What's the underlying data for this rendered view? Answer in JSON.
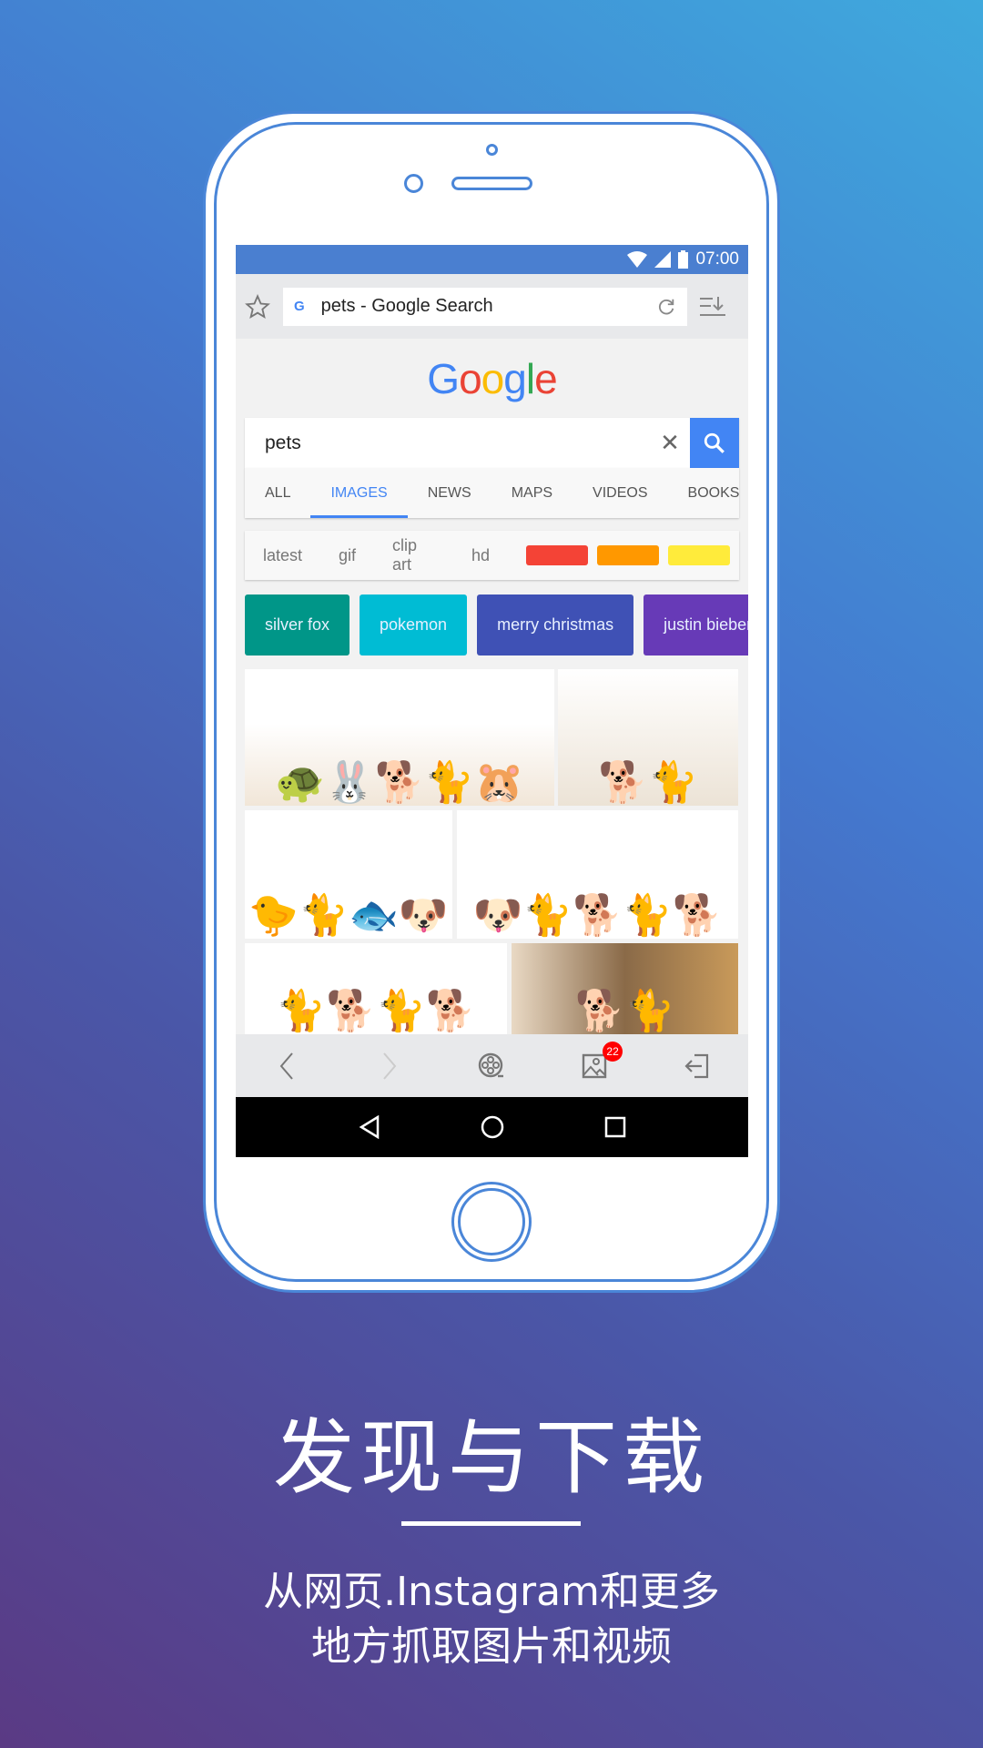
{
  "status": {
    "time": "07:00"
  },
  "urlbar": {
    "title": "pets - Google Search"
  },
  "logo": {
    "letters": [
      "G",
      "o",
      "o",
      "g",
      "l",
      "e"
    ],
    "colors": [
      "#4285f4",
      "#ea4335",
      "#fbbc05",
      "#4285f4",
      "#34a853",
      "#ea4335"
    ]
  },
  "search": {
    "query": "pets"
  },
  "tabs": [
    {
      "label": "ALL"
    },
    {
      "label": "IMAGES",
      "active": true
    },
    {
      "label": "NEWS"
    },
    {
      "label": "MAPS"
    },
    {
      "label": "VIDEOS"
    },
    {
      "label": "BOOKS"
    }
  ],
  "filters": {
    "labels": [
      "latest",
      "gif",
      "clip art",
      "hd"
    ],
    "swatches": [
      "#f44336",
      "#ff9800",
      "#ffeb3b"
    ]
  },
  "chips": [
    {
      "label": "silver fox",
      "color": "#009688"
    },
    {
      "label": "pokemon",
      "color": "#00bcd4"
    },
    {
      "label": "merry christmas",
      "color": "#3f51b5"
    },
    {
      "label": "justin bieber",
      "color": "#673ab7"
    }
  ],
  "toolbar": {
    "badge": "22"
  },
  "headline": "发现与下载",
  "subtitle": {
    "line1": "从网页.Instagram和更多",
    "line2": "地方抓取图片和视频"
  },
  "accent": "#4285f4"
}
